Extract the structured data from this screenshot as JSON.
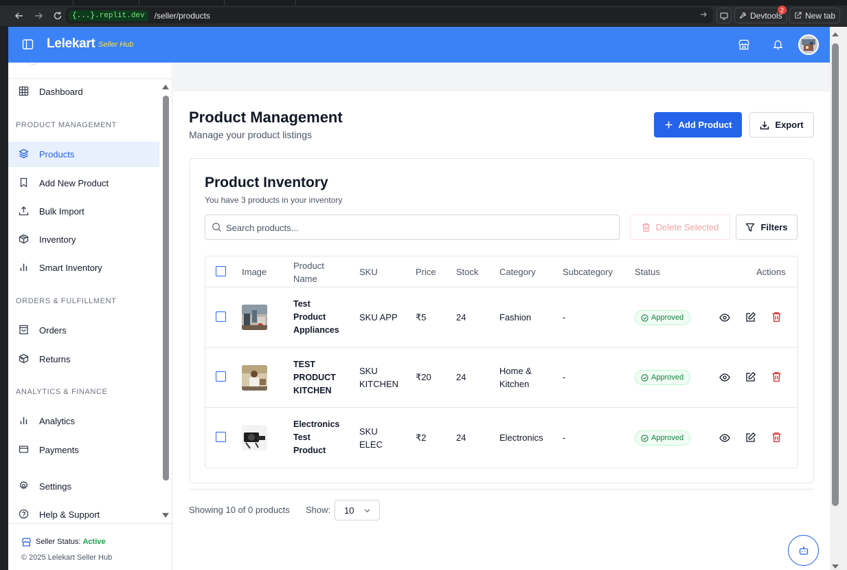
{
  "browser": {
    "url_host_prefix": "{...}",
    "url_host_suffix": ".replit.dev",
    "url_path": "/seller/products",
    "devtools_label": "Devtools",
    "devtools_badge": "2",
    "new_tab_label": "New tab"
  },
  "topbar": {
    "logo": "Lelekart",
    "logo_sub": "Seller Hub",
    "icons": [
      "store-icon",
      "bell-icon",
      "avatar"
    ]
  },
  "sidebar": {
    "items": [
      {
        "label": "Dashboard",
        "icon": "grid-icon"
      },
      {
        "label": "Products",
        "icon": "layers-icon",
        "active": true
      },
      {
        "label": "Add New Product",
        "icon": "bookmark-icon"
      },
      {
        "label": "Bulk Import",
        "icon": "upload-icon"
      },
      {
        "label": "Inventory",
        "icon": "package-icon"
      },
      {
        "label": "Smart Inventory",
        "icon": "bar-chart-icon"
      },
      {
        "label": "Orders",
        "icon": "shopping-bag-icon"
      },
      {
        "label": "Returns",
        "icon": "box-return-icon"
      },
      {
        "label": "Analytics",
        "icon": "bar-chart-icon"
      },
      {
        "label": "Payments",
        "icon": "credit-card-icon"
      },
      {
        "label": "Settings",
        "icon": "gear-icon"
      },
      {
        "label": "Help & Support",
        "icon": "help-circle-icon"
      }
    ],
    "sections": {
      "product_management": "PRODUCT MANAGEMENT",
      "orders_fulfillment": "ORDERS & FULFILLMENT",
      "analytics_finance": "ANALYTICS & FINANCE"
    },
    "footer": {
      "status_label": "Seller Status:",
      "status_value": "Active",
      "copyright": "© 2025 Lelekart Seller Hub"
    }
  },
  "page": {
    "title": "Product Management",
    "subtitle": "Manage your product listings",
    "add_button": "Add Product",
    "export_button": "Export"
  },
  "inventory": {
    "title": "Product Inventory",
    "subtitle": "You have 3 products in your inventory",
    "search_placeholder": "Search products...",
    "delete_button": "Delete Selected",
    "filters_button": "Filters",
    "columns": [
      "Image",
      "Product Name",
      "SKU",
      "Price",
      "Stock",
      "Category",
      "Subcategory",
      "Status",
      "Actions"
    ],
    "rows": [
      {
        "name": "Test Product Appliances",
        "sku": "SKU APP",
        "price": "₹5",
        "stock": "24",
        "category": "Fashion",
        "subcategory": "-",
        "status": "Approved"
      },
      {
        "name": "TEST PRODUCT KITCHEN",
        "sku": "SKU KITCHEN",
        "price": "₹20",
        "stock": "24",
        "category": "Home & Kitchen",
        "subcategory": "-",
        "status": "Approved"
      },
      {
        "name": "Electronics Test Product",
        "sku": "SKU ELEC",
        "price": "₹2",
        "stock": "24",
        "category": "Electronics",
        "subcategory": "-",
        "status": "Approved"
      }
    ]
  },
  "pagination": {
    "showing": "Showing 10 of 0 products",
    "show_label": "Show:",
    "page_size": "10"
  },
  "colors": {
    "brand": "#3b82f6",
    "primary_button": "#2563eb",
    "status_green": "#15803d",
    "delete_red": "#dc2626"
  }
}
